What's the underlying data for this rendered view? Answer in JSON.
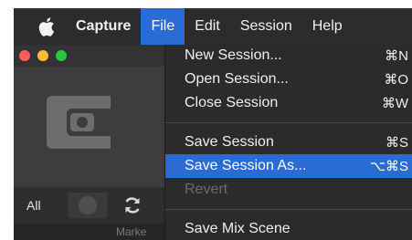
{
  "menubar": {
    "app_name": "Capture",
    "items": [
      "File",
      "Edit",
      "Session",
      "Help"
    ],
    "active_index": 0,
    "apple_icon": "apple-logo-icon"
  },
  "window": {
    "toolbar": {
      "all_label": "All",
      "refresh_icon": "refresh-icon"
    },
    "marker_label": "Marke",
    "logo_icon": "capture-logo-icon"
  },
  "file_menu": {
    "items": [
      {
        "label": "New Session...",
        "shortcut": "⌘N",
        "enabled": true
      },
      {
        "label": "Open Session...",
        "shortcut": "⌘O",
        "enabled": true
      },
      {
        "label": "Close Session",
        "shortcut": "⌘W",
        "enabled": true
      },
      {
        "label": "Save Session",
        "shortcut": "⌘S",
        "enabled": true
      },
      {
        "label": "Save Session As...",
        "shortcut": "⌥⌘S",
        "enabled": true,
        "highlighted": true
      },
      {
        "label": "Revert",
        "shortcut": "",
        "enabled": false
      },
      {
        "label": "Save Mix Scene",
        "shortcut": "",
        "enabled": true
      }
    ]
  },
  "colors": {
    "menubar_bg": "#2c2b2d",
    "highlight": "#2a6bd4",
    "text": "#f0f0f0",
    "disabled_text": "#6b6b6d"
  }
}
